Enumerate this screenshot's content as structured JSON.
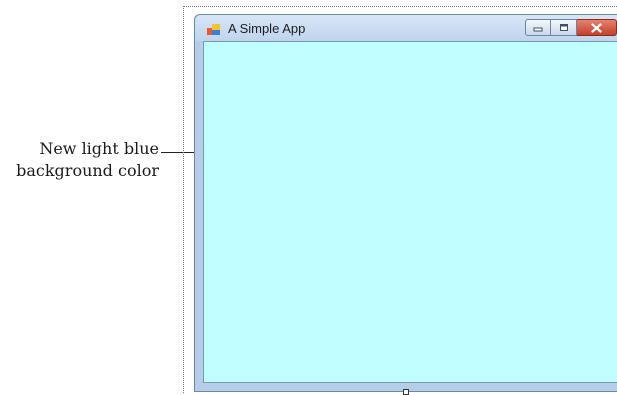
{
  "window": {
    "title": "A Simple App",
    "icon": "app-form-icon",
    "client_background_color": "#c0ffff"
  },
  "controls": {
    "minimize_icon": "minimize-icon",
    "maximize_icon": "maximize-icon",
    "close_icon": "close-icon"
  },
  "callout": {
    "line1": "New light blue",
    "line2": "background color"
  }
}
